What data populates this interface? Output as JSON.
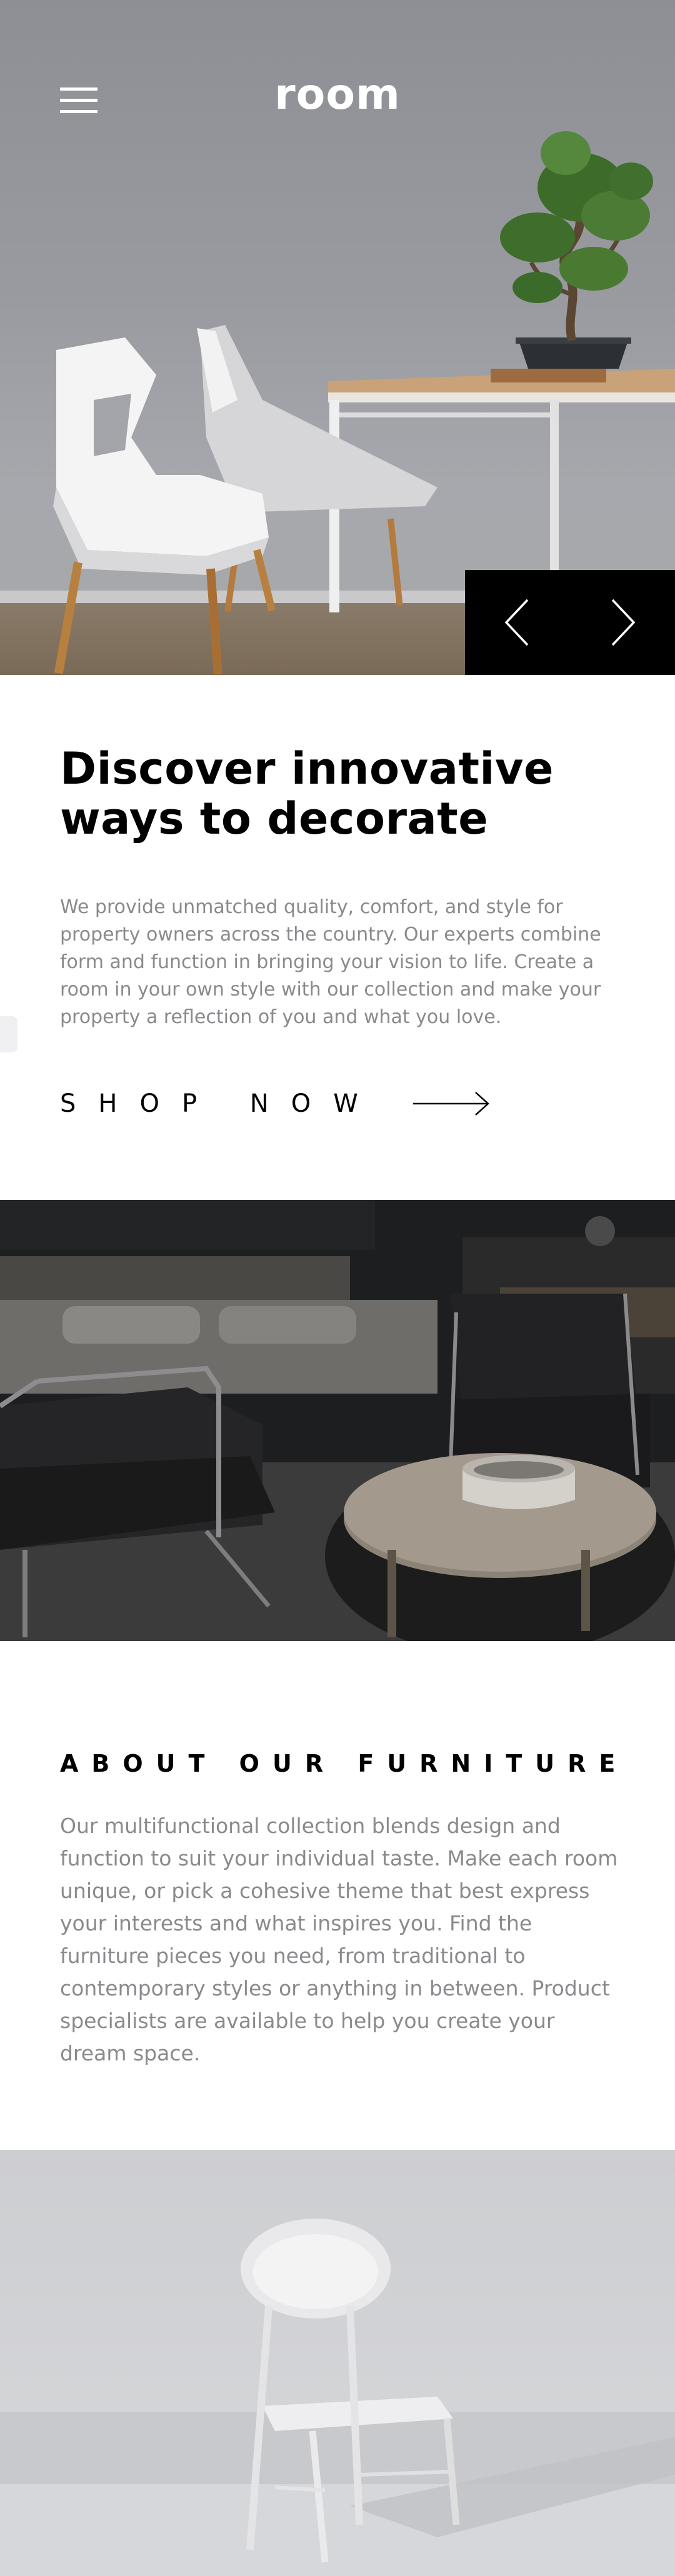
{
  "header": {
    "logo": "room",
    "menu_icon": "hamburger-menu-icon"
  },
  "hero": {
    "image_description_icon": "hero-photo",
    "slider": {
      "prev_icon": "chevron-left-icon",
      "next_icon": "chevron-right-icon"
    }
  },
  "intro": {
    "title": "Discover innovative ways to decorate",
    "body": "We provide unmatched quality, comfort, and style for property owners across the country. Our experts combine form and function in bringing your vision to life. Create a room in your own style with our collection and make your property a reflection of you and what you love.",
    "cta_label": "SHOP NOW",
    "cta_icon": "arrow-right-icon"
  },
  "about": {
    "title": "ABOUT OUR FURNITURE",
    "body": "Our multifunctional collection blends design and function to suit your individual taste. Make each room unique, or pick a cohesive theme that best express your interests and what inspires you. Find the furniture pieces you need, from traditional to contemporary styles or anything in between. Product specialists are available to help you create your dream space."
  },
  "colors": {
    "accent": "#000000",
    "body_text": "#8a8a8e",
    "background": "#ffffff"
  }
}
